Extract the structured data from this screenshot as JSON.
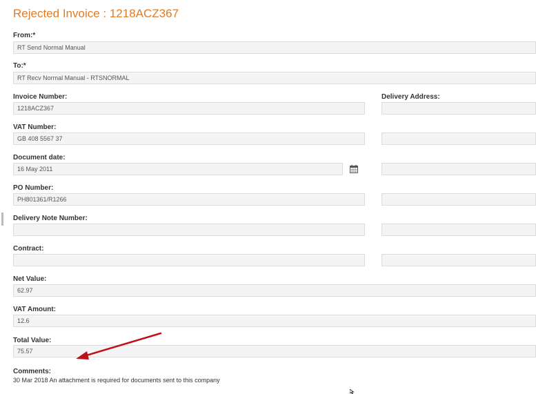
{
  "page": {
    "title": "Rejected Invoice : 1218ACZ367"
  },
  "from": {
    "label": "From:*",
    "value": "RT Send Normal Manual"
  },
  "to": {
    "label": "To:*",
    "value": "RT Recv Normal Manual - RTSNORMAL"
  },
  "invoice_number": {
    "label": "Invoice Number:",
    "value": "1218ACZ367"
  },
  "delivery_address": {
    "label": "Delivery Address:",
    "lines": [
      "",
      "",
      "",
      "",
      "",
      ""
    ]
  },
  "vat_number": {
    "label": "VAT Number:",
    "value": "GB 408 5567 37"
  },
  "document_date": {
    "label": "Document date:",
    "value": "16 May 2011",
    "icon": "calendar-icon"
  },
  "po_number": {
    "label": "PO Number:",
    "value": "PH801361/R1266"
  },
  "delivery_note_number": {
    "label": "Delivery Note Number:",
    "value": ""
  },
  "contract": {
    "label": "Contract:",
    "value": ""
  },
  "net_value": {
    "label": "Net Value:",
    "value": "62.97"
  },
  "vat_amount": {
    "label": "VAT Amount:",
    "value": "12.6"
  },
  "total_value": {
    "label": "Total Value:",
    "value": "75.57"
  },
  "comments": {
    "label": "Comments:",
    "text": "30 Mar 2018 An attachment is required for documents sent to this company"
  },
  "colors": {
    "title": "#e07b26",
    "arrow": "#c0111a",
    "field_bg": "#f4f4f4",
    "field_border": "#dcdcdc"
  }
}
